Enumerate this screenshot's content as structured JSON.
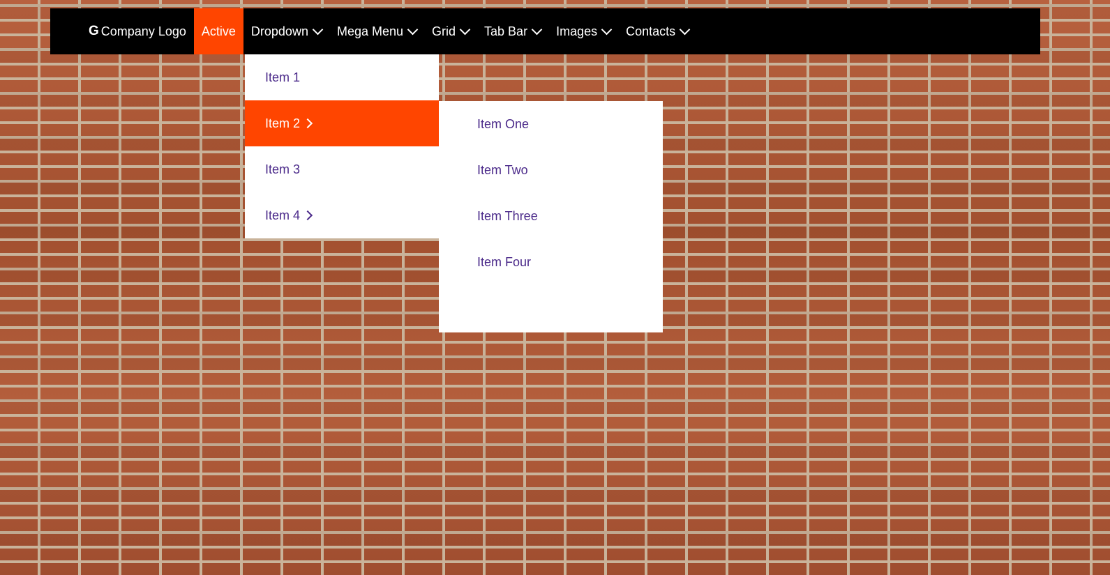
{
  "navbar": {
    "logo_label": "Company Logo",
    "items": [
      {
        "label": "Active"
      },
      {
        "label": "Dropdown"
      },
      {
        "label": "Mega Menu"
      },
      {
        "label": "Grid"
      },
      {
        "label": "Tab Bar"
      },
      {
        "label": "Images"
      },
      {
        "label": "Contacts"
      }
    ]
  },
  "dropdown": {
    "items": [
      {
        "label": "Item 1"
      },
      {
        "label": "Item 2"
      },
      {
        "label": "Item 3"
      },
      {
        "label": "Item 4"
      }
    ]
  },
  "submenu": {
    "items": [
      {
        "label": "Item One"
      },
      {
        "label": "Item Two"
      },
      {
        "label": "Item Three"
      },
      {
        "label": "Item Four"
      }
    ]
  },
  "colors": {
    "navbar_bg": "#000000",
    "accent": "#ff4500",
    "menu_text": "#4b2a8a",
    "menu_bg": "#ffffff"
  },
  "icons": {
    "logo": "google-g-icon",
    "dropdown_indicator": "chevron-down-icon",
    "submenu_indicator": "chevron-right-icon"
  },
  "background": "brick-wall"
}
